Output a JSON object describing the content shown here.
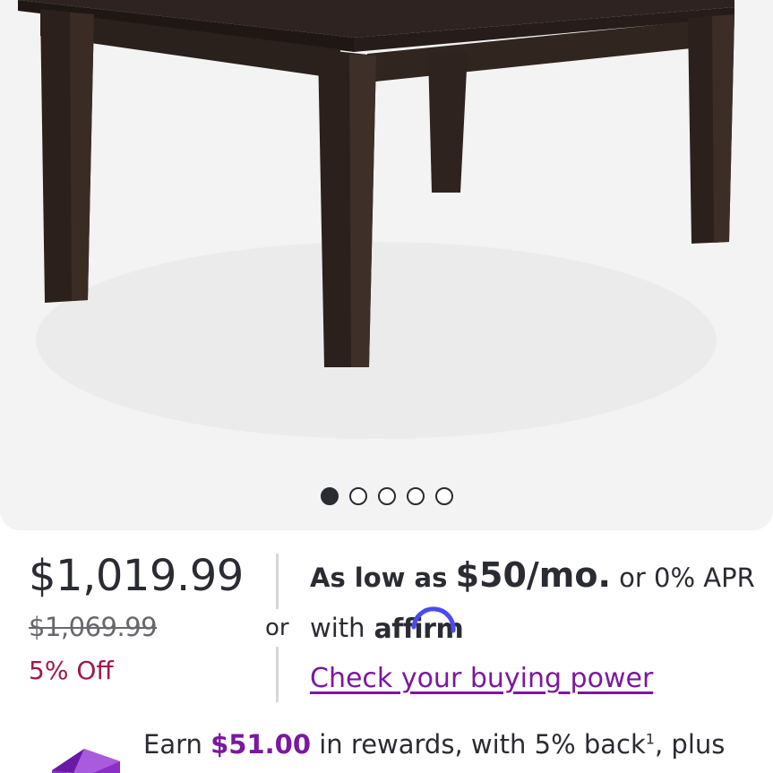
{
  "carousel": {
    "slide_count": 5,
    "active_index": 0
  },
  "price": {
    "current": "$1,019.99",
    "original": "$1,069.99",
    "discount": "5% Off"
  },
  "separator": {
    "or_label": "or"
  },
  "financing": {
    "prefix": "As low as",
    "monthly": "$50/mo.",
    "suffix": "or 0% APR",
    "with_label": "with",
    "provider": "affirm",
    "buying_power_link": "Check your buying power"
  },
  "rewards": {
    "earn_label": "Earn",
    "amount": "$51.00",
    "middle_text": "in rewards, with 5% back",
    "footnote": "1",
    "tail_text": ", plus"
  },
  "colors": {
    "accent_purple": "#7b189f",
    "discount_red": "#a3164a",
    "text_dark": "#2b2b33",
    "image_bg": "#f3f3f3"
  }
}
